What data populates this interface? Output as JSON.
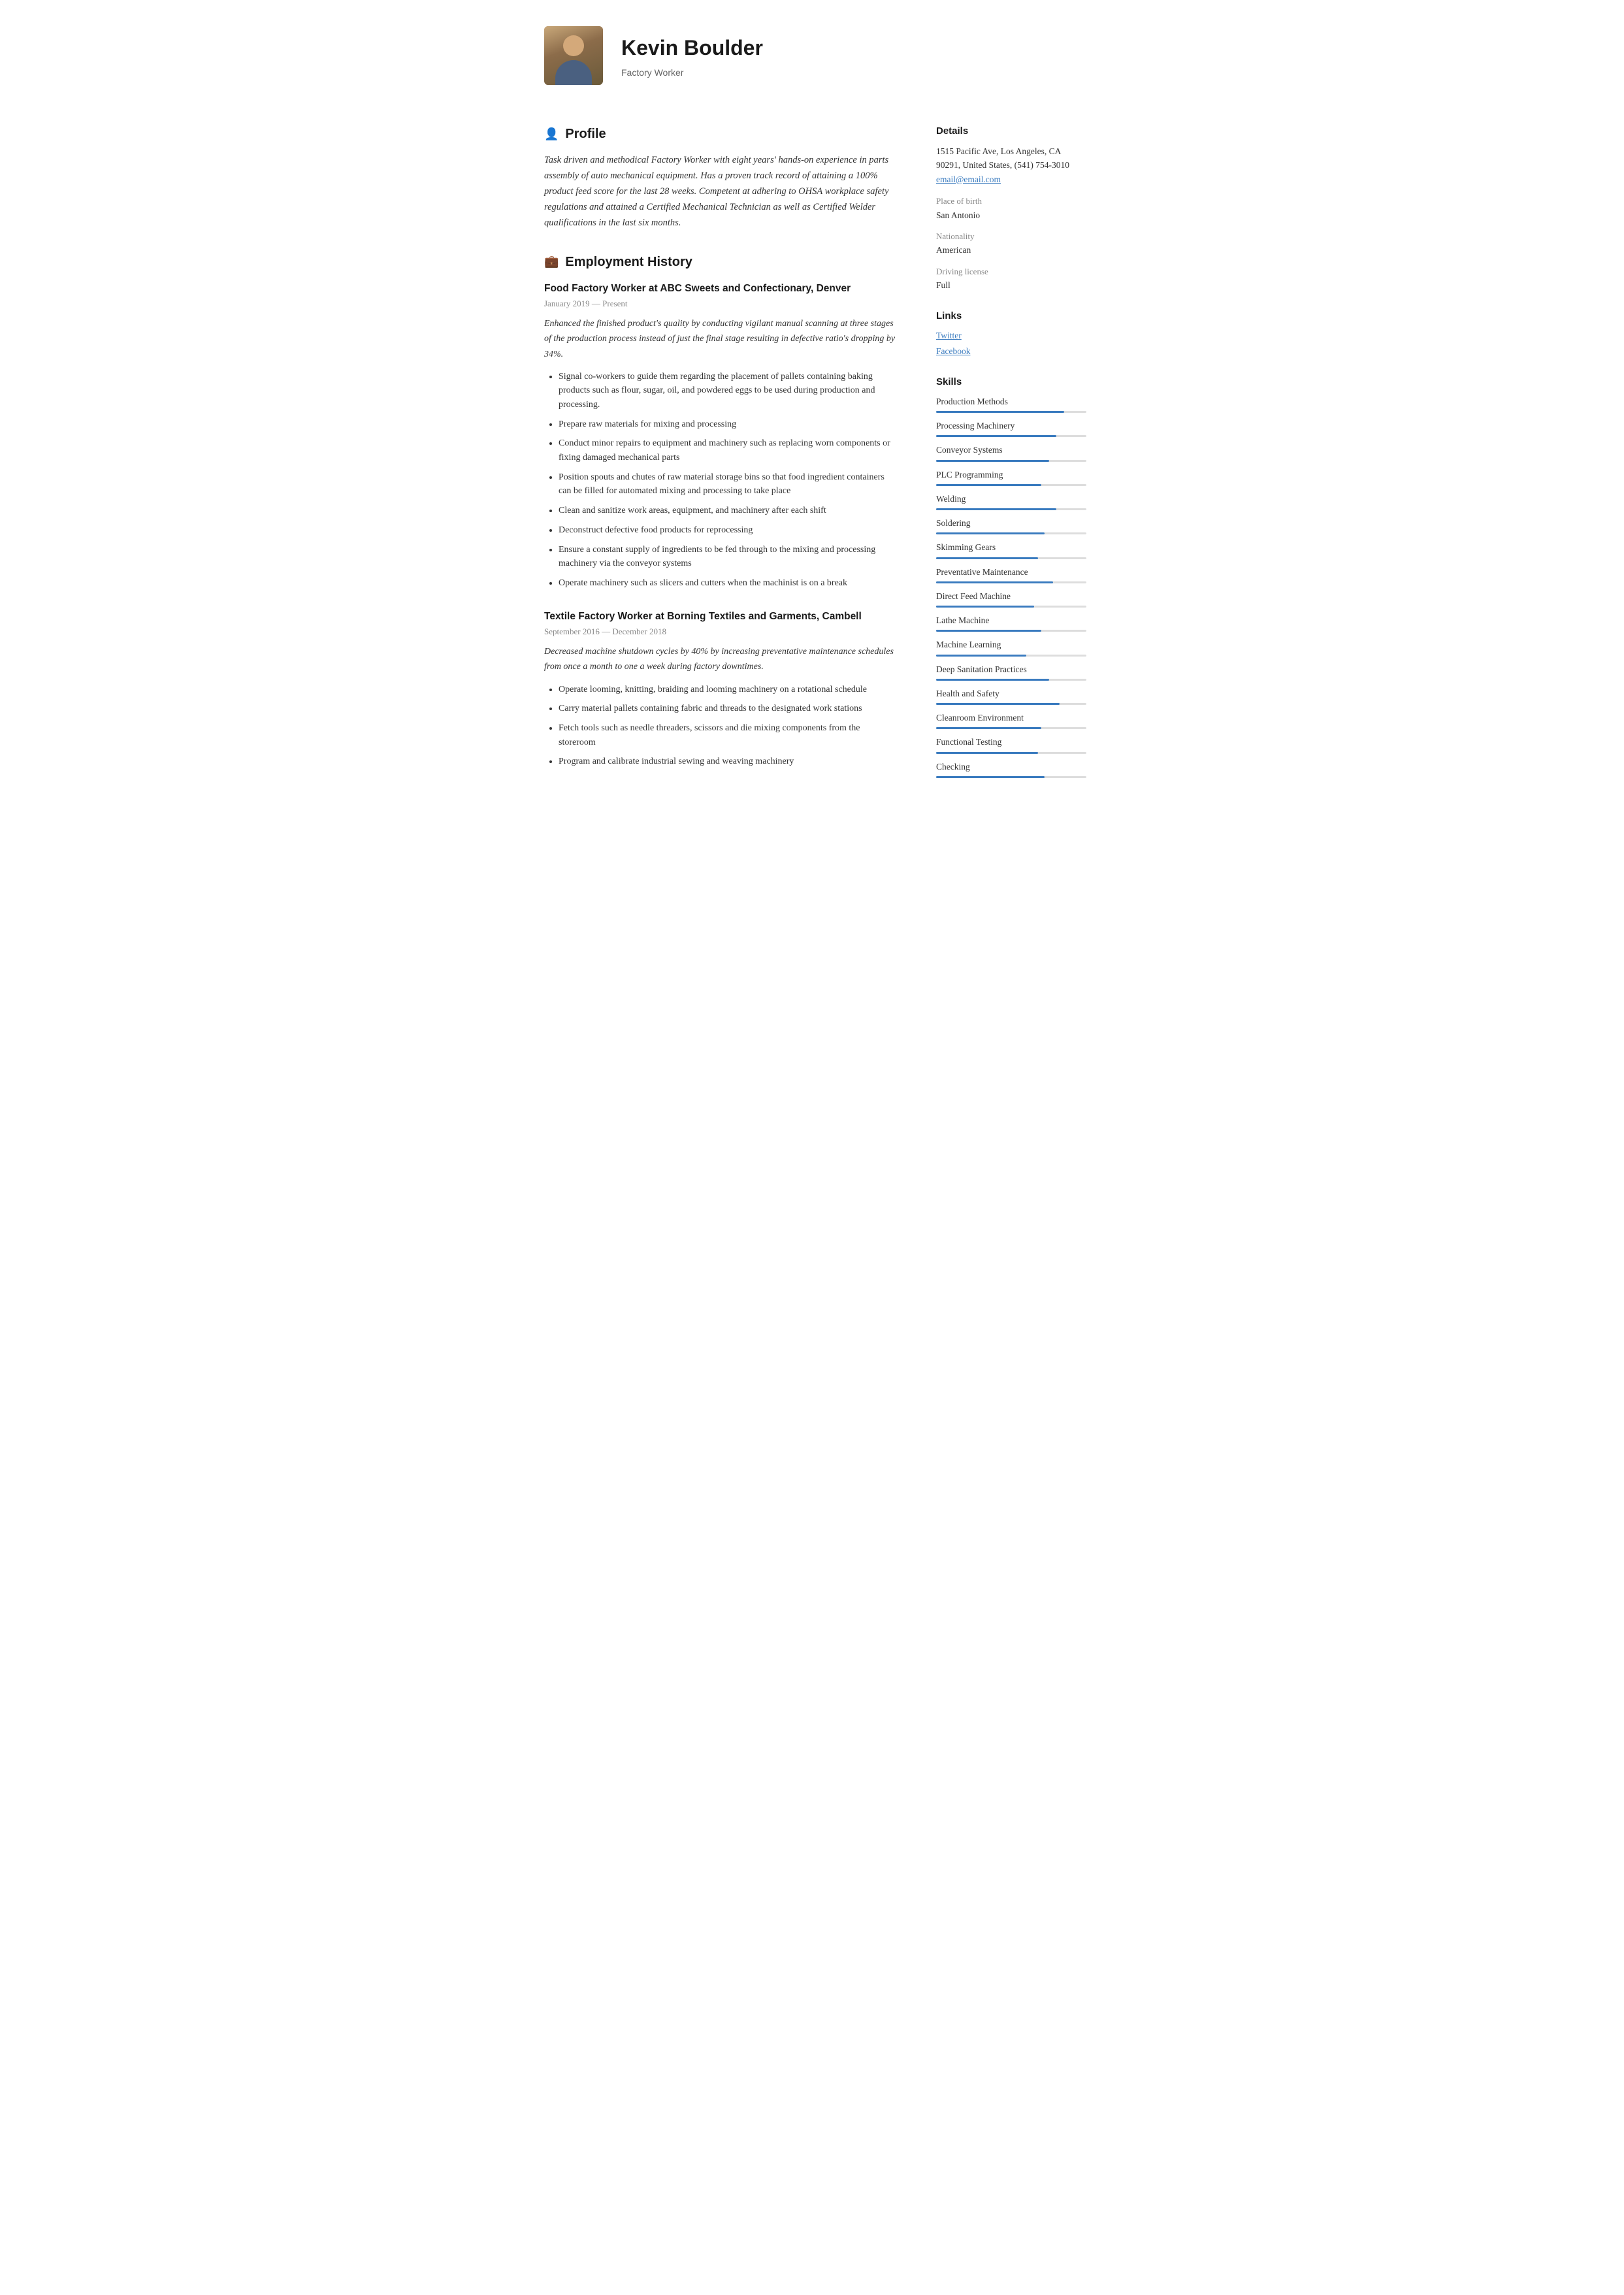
{
  "header": {
    "name": "Kevin Boulder",
    "job_title": "Factory Worker",
    "avatar_alt": "Kevin Boulder profile photo"
  },
  "profile": {
    "section_title": "Profile",
    "section_icon": "👤",
    "text": "Task driven and methodical Factory Worker with eight years' hands-on experience in parts assembly of auto mechanical equipment. Has a proven track record of attaining a 100% product feed score for the last 28 weeks. Competent at adhering to OHSA workplace safety regulations and attained a Certified Mechanical Technician as well as Certified Welder qualifications in the last six months."
  },
  "employment": {
    "section_title": "Employment History",
    "section_icon": "💼",
    "jobs": [
      {
        "title": "Food Factory Worker at  ABC Sweets and Confectionary, Denver",
        "dates": "January 2019 — Present",
        "description": "Enhanced the finished product's quality by conducting vigilant manual scanning at three stages of the production process instead of just the final stage resulting in defective ratio's dropping by 34%.",
        "bullets": [
          "Signal co-workers to guide them regarding the placement of pallets containing baking products such as flour, sugar, oil, and powdered eggs to be used during production and processing.",
          "Prepare raw materials for mixing and processing",
          "Conduct minor repairs to equipment and machinery such as replacing worn components or fixing damaged mechanical parts",
          "Position spouts and chutes of raw material storage bins so that food ingredient containers can be filled for automated mixing and processing to take place",
          "Clean and sanitize work areas, equipment, and machinery after each shift",
          "Deconstruct defective food products for reprocessing",
          "Ensure a constant supply of ingredients to be fed through to the mixing and processing machinery via the conveyor systems",
          "Operate machinery such as slicers and cutters when the machinist is on a break"
        ]
      },
      {
        "title": "Textile Factory Worker at  Borning Textiles and Garments, Cambell",
        "dates": "September 2016 — December 2018",
        "description": "Decreased machine shutdown cycles by 40% by increasing preventative maintenance schedules from once a month to one a week during factory downtimes.",
        "bullets": [
          "Operate looming, knitting, braiding and looming machinery on a rotational schedule",
          "Carry material pallets containing fabric and threads to the designated work stations",
          "Fetch tools such as needle threaders, scissors and die mixing components from the storeroom",
          "Program and calibrate industrial sewing and weaving machinery"
        ]
      }
    ]
  },
  "details": {
    "section_title": "Details",
    "address": "1515 Pacific Ave, Los Angeles, CA 90291, United States, (541) 754-3010",
    "email": "email@email.com",
    "place_of_birth_label": "Place of birth",
    "place_of_birth": "San Antonio",
    "nationality_label": "Nationality",
    "nationality": "American",
    "driving_license_label": "Driving license",
    "driving_license": "Full"
  },
  "links": {
    "section_title": "Links",
    "items": [
      {
        "label": "Twitter",
        "url": "#"
      },
      {
        "label": "Facebook",
        "url": "#"
      }
    ]
  },
  "skills": {
    "section_title": "Skills",
    "items": [
      {
        "name": "Production Methods",
        "percent": 85
      },
      {
        "name": "Processing Machinery",
        "percent": 80
      },
      {
        "name": "Conveyor Systems",
        "percent": 75
      },
      {
        "name": "PLC Programming",
        "percent": 70
      },
      {
        "name": "Welding",
        "percent": 80
      },
      {
        "name": "Soldering",
        "percent": 72
      },
      {
        "name": "Skimming Gears",
        "percent": 68
      },
      {
        "name": "Preventative Maintenance",
        "percent": 78
      },
      {
        "name": "Direct Feed Machine",
        "percent": 65
      },
      {
        "name": "Lathe Machine",
        "percent": 70
      },
      {
        "name": "Machine Learning",
        "percent": 60
      },
      {
        "name": "Deep Sanitation Practices",
        "percent": 75
      },
      {
        "name": "Health and Safety",
        "percent": 82
      },
      {
        "name": "Cleanroom Environment",
        "percent": 70
      },
      {
        "name": "Functional Testing",
        "percent": 68
      },
      {
        "name": "Checking",
        "percent": 72
      }
    ]
  }
}
